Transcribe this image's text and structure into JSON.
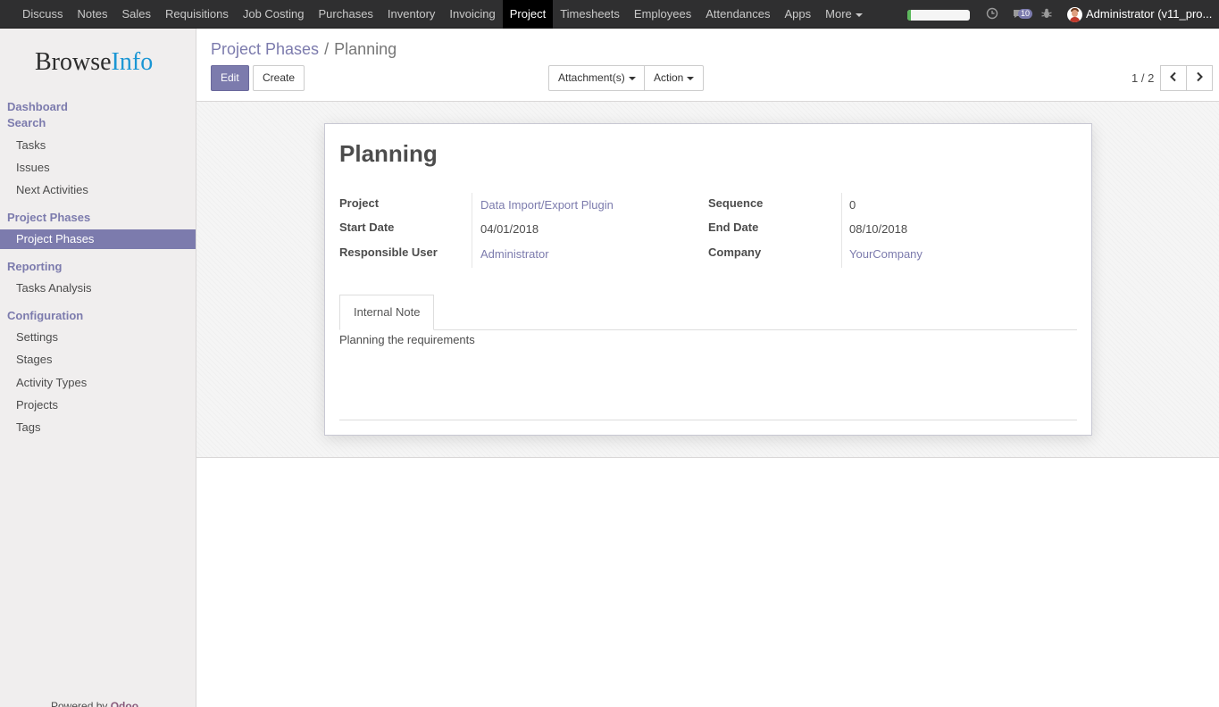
{
  "topbar": {
    "menu": [
      "Discuss",
      "Notes",
      "Sales",
      "Requisitions",
      "Job Costing",
      "Purchases",
      "Inventory",
      "Invoicing",
      "Project",
      "Timesheets",
      "Employees",
      "Attendances",
      "Apps"
    ],
    "more_label": "More",
    "active_menu": "Project",
    "progress_fraction": 0.06,
    "messages_count": "10",
    "user_name": "Administrator (v11_pro..."
  },
  "sidebar": {
    "logo_main": "Browse",
    "logo_accent": "Info",
    "sections": [
      {
        "title": "Dashboard"
      },
      {
        "title": "Search",
        "items": [
          "Tasks",
          "Issues",
          "Next Activities"
        ]
      },
      {
        "title": "Project Phases",
        "items": [
          "Project Phases"
        ]
      },
      {
        "title": "Reporting",
        "items": [
          "Tasks Analysis"
        ]
      },
      {
        "title": "Configuration",
        "items": [
          "Settings",
          "Stages",
          "Activity Types",
          "Projects",
          "Tags"
        ]
      }
    ],
    "active_item": "Project Phases",
    "powered_prefix": "Powered by ",
    "powered_brand": "Odoo"
  },
  "control_panel": {
    "breadcrumb_parent": "Project Phases",
    "breadcrumb_sep": "/",
    "breadcrumb_current": "Planning",
    "edit_label": "Edit",
    "create_label": "Create",
    "attachments_label": "Attachment(s)",
    "action_label": "Action",
    "pager": "1 / 2"
  },
  "record": {
    "title": "Planning",
    "project_label": "Project",
    "project_value": "Data Import/Export Plugin",
    "start_date_label": "Start Date",
    "start_date_value": "04/01/2018",
    "responsible_label": "Responsible User",
    "responsible_value": "Administrator",
    "sequence_label": "Sequence",
    "sequence_value": "0",
    "end_date_label": "End Date",
    "end_date_value": "08/10/2018",
    "company_label": "Company",
    "company_value": "YourCompany",
    "tab_label": "Internal Note",
    "note": "Planning the requirements"
  },
  "colors": {
    "brand": "#7c7bad",
    "topbar": "#2f2f30",
    "progress": "#5cb85c",
    "logo_accent": "#1a96d4"
  }
}
